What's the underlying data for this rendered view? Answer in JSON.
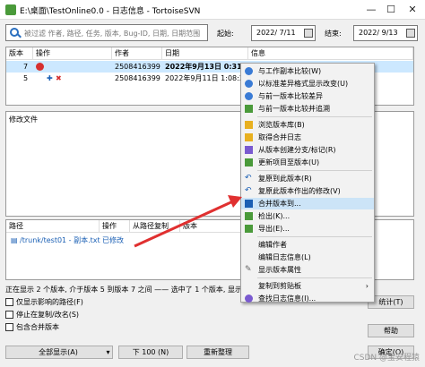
{
  "window": {
    "title": "E:\\桌面\\TestOnline0.0 - 日志信息 - TortoiseSVN",
    "min": "—",
    "max": "☐",
    "close": "✕"
  },
  "search": {
    "placeholder": "被过滤 作者, 路径, 任务, 版本, Bug-ID, 日期, 日期范围"
  },
  "filters": {
    "from_label": "起始:",
    "from_date": "2022/ 7/11",
    "to_label": "结束:",
    "to_date": "2022/ 9/13"
  },
  "log": {
    "columns": [
      "版本",
      "操作",
      "作者",
      "日期",
      "信息"
    ],
    "rows": [
      {
        "rev": "7",
        "author": "2508416399",
        "date": "2022年9月13日 0:31:50",
        "msg": ""
      },
      {
        "rev": "5",
        "author": "2508416399",
        "date": "2022年9月11日 1:08:21",
        "msg": ""
      }
    ]
  },
  "changed_label": "修改文件",
  "paths": {
    "columns": [
      "路径",
      "操作",
      "从路径复制",
      "版本"
    ],
    "rows": [
      {
        "path": "/trunk/test01 - 副本.txt",
        "action": "已修改"
      }
    ]
  },
  "status": "正在显示 2 个版本, 介于版本 5 到版本 7 之间 —— 选中了 1 个版本, 显示 1 个修改",
  "options": [
    "仅显示影响的路径(F)",
    "停止在复制/改名(S)",
    "包含合并版本"
  ],
  "buttons": {
    "show_all": "全部显示(A)",
    "next100": "下 100 (N)",
    "refresh": "重新整理",
    "stats": "统计(T)",
    "help": "帮助",
    "ok": "确定(O)"
  },
  "context_menu": [
    "与工作副本比较(W)",
    "以标准差异格式显示改变(U)",
    "与前一版本比较差异",
    "与前一版本比较并追溯",
    "浏览版本库(B)",
    "取得合并日志",
    "从版本创建分支/标记(R)",
    "更新项目至版本(U)",
    "复原到此版本(R)",
    "复原此版本作出的修改(V)",
    "合并版本到...",
    "检出(K)...",
    "导出(E)...",
    "编辑作者",
    "编辑日志信息(L)",
    "显示版本属性",
    "复制到剪贴板",
    "查找日志信息(I)..."
  ],
  "submenu_arrow": "›",
  "watermark": "CSDN @宝安程猿",
  "colors": {
    "accent": "#1a5fb4",
    "selection": "#cce8ff",
    "arrow": "#e03030"
  }
}
